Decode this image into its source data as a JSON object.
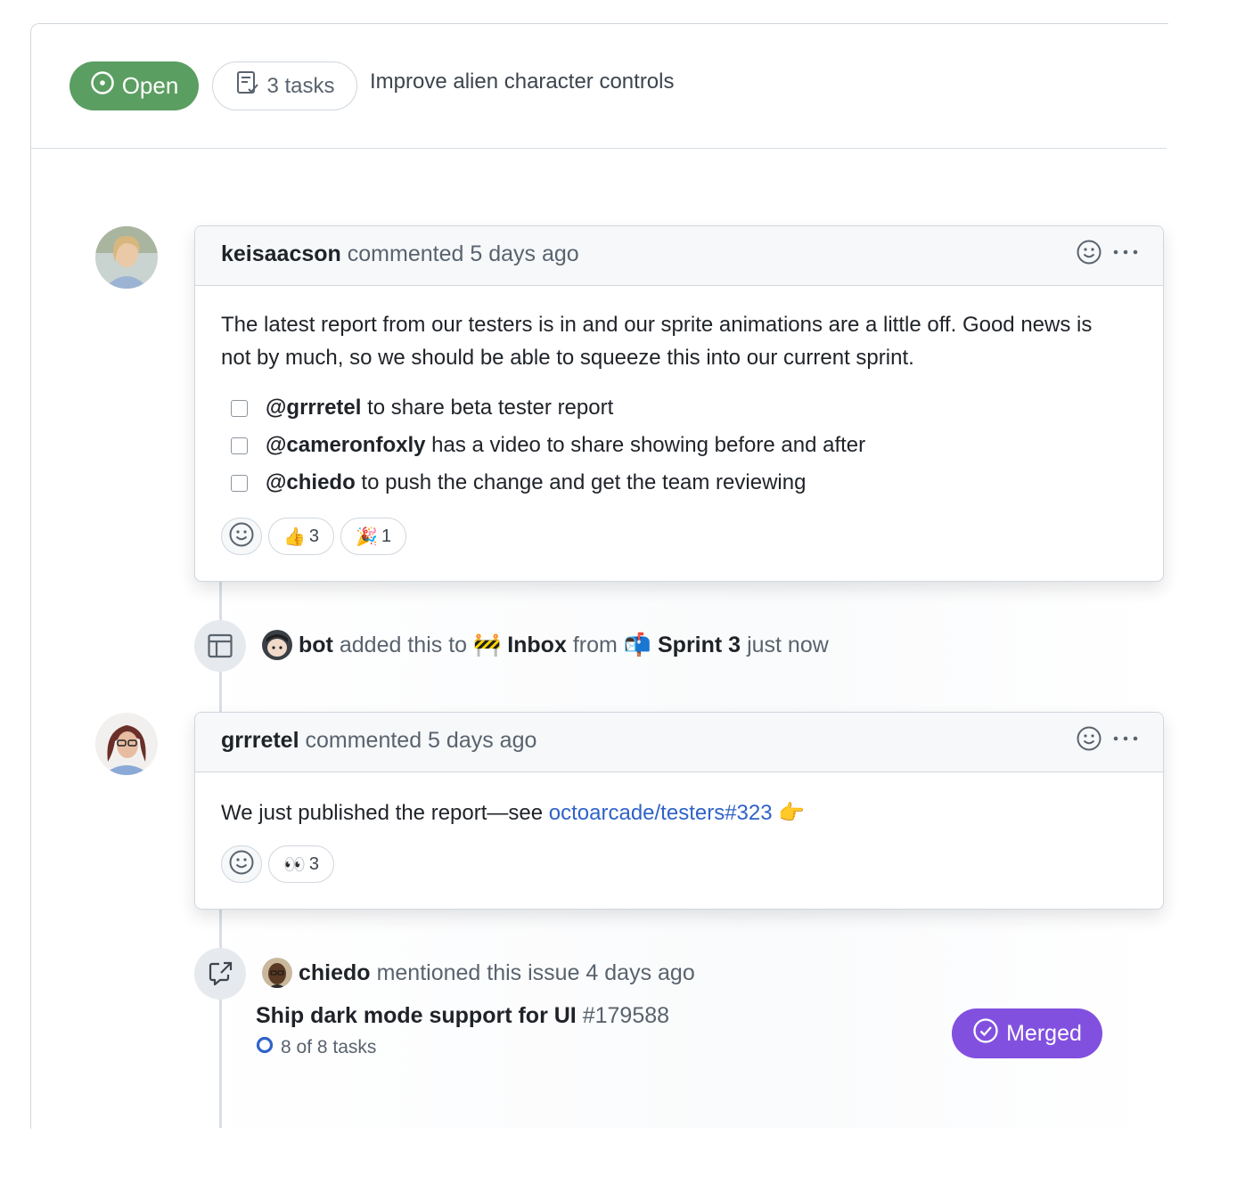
{
  "issue": {
    "state_label": "Open",
    "tasks_label": "3 tasks",
    "title": "Improve alien character controls"
  },
  "comments": [
    {
      "author": "keisaacson",
      "action": "commented 5 days ago",
      "body": "The latest report from our testers is in and our sprite animations are a little off. Good news is not by much, so we should be able to squeeze this into our current sprint.",
      "tasks": [
        {
          "mention": "@grrretel",
          "text": "to share beta tester report"
        },
        {
          "mention": "@cameronfoxly",
          "text": "has a video to share showing before and after"
        },
        {
          "mention": "@chiedo",
          "text": "to push the change and get the team reviewing"
        }
      ],
      "reactions": [
        {
          "emoji": "👍",
          "count": "3"
        },
        {
          "emoji": "🎉",
          "count": "1"
        }
      ]
    },
    {
      "author": "grrretel",
      "action": "commented 5 days ago",
      "body_prefix": "We just published the report—see",
      "link_text": "octoarcade/testers#323",
      "body_suffix": "👉",
      "reactions": [
        {
          "emoji": "👀",
          "count": "3"
        }
      ]
    }
  ],
  "project_event": {
    "actor": "bot",
    "action": "added this to",
    "to_emoji": "🚧",
    "to_name": "Inbox",
    "from_word": "from",
    "from_emoji": "📬",
    "from_name": "Sprint 3",
    "time": "just now"
  },
  "mention_event": {
    "actor": "chiedo",
    "action": "mentioned this issue 4 days ago",
    "pr_title": "Ship dark mode support for UI",
    "pr_number": "#179588",
    "pr_tasks": "8 of 8 tasks",
    "pr_state": "Merged"
  },
  "colors": {
    "open": "#5b9e61",
    "merged": "#8250df",
    "link": "#2f63c9"
  }
}
